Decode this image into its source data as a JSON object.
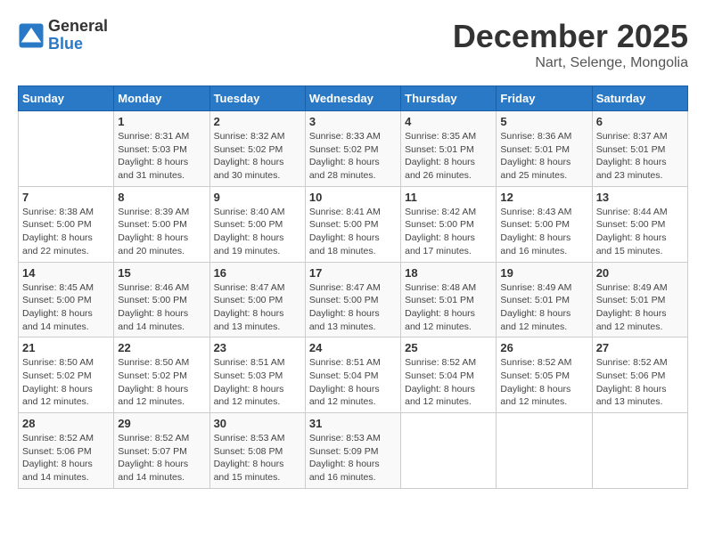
{
  "logo": {
    "line1": "General",
    "line2": "Blue"
  },
  "title": "December 2025",
  "subtitle": "Nart, Selenge, Mongolia",
  "weekdays": [
    "Sunday",
    "Monday",
    "Tuesday",
    "Wednesday",
    "Thursday",
    "Friday",
    "Saturday"
  ],
  "weeks": [
    [
      {
        "day": "",
        "info": ""
      },
      {
        "day": "1",
        "info": "Sunrise: 8:31 AM\nSunset: 5:03 PM\nDaylight: 8 hours\nand 31 minutes."
      },
      {
        "day": "2",
        "info": "Sunrise: 8:32 AM\nSunset: 5:02 PM\nDaylight: 8 hours\nand 30 minutes."
      },
      {
        "day": "3",
        "info": "Sunrise: 8:33 AM\nSunset: 5:02 PM\nDaylight: 8 hours\nand 28 minutes."
      },
      {
        "day": "4",
        "info": "Sunrise: 8:35 AM\nSunset: 5:01 PM\nDaylight: 8 hours\nand 26 minutes."
      },
      {
        "day": "5",
        "info": "Sunrise: 8:36 AM\nSunset: 5:01 PM\nDaylight: 8 hours\nand 25 minutes."
      },
      {
        "day": "6",
        "info": "Sunrise: 8:37 AM\nSunset: 5:01 PM\nDaylight: 8 hours\nand 23 minutes."
      }
    ],
    [
      {
        "day": "7",
        "info": "Sunrise: 8:38 AM\nSunset: 5:00 PM\nDaylight: 8 hours\nand 22 minutes."
      },
      {
        "day": "8",
        "info": "Sunrise: 8:39 AM\nSunset: 5:00 PM\nDaylight: 8 hours\nand 20 minutes."
      },
      {
        "day": "9",
        "info": "Sunrise: 8:40 AM\nSunset: 5:00 PM\nDaylight: 8 hours\nand 19 minutes."
      },
      {
        "day": "10",
        "info": "Sunrise: 8:41 AM\nSunset: 5:00 PM\nDaylight: 8 hours\nand 18 minutes."
      },
      {
        "day": "11",
        "info": "Sunrise: 8:42 AM\nSunset: 5:00 PM\nDaylight: 8 hours\nand 17 minutes."
      },
      {
        "day": "12",
        "info": "Sunrise: 8:43 AM\nSunset: 5:00 PM\nDaylight: 8 hours\nand 16 minutes."
      },
      {
        "day": "13",
        "info": "Sunrise: 8:44 AM\nSunset: 5:00 PM\nDaylight: 8 hours\nand 15 minutes."
      }
    ],
    [
      {
        "day": "14",
        "info": "Sunrise: 8:45 AM\nSunset: 5:00 PM\nDaylight: 8 hours\nand 14 minutes."
      },
      {
        "day": "15",
        "info": "Sunrise: 8:46 AM\nSunset: 5:00 PM\nDaylight: 8 hours\nand 14 minutes."
      },
      {
        "day": "16",
        "info": "Sunrise: 8:47 AM\nSunset: 5:00 PM\nDaylight: 8 hours\nand 13 minutes."
      },
      {
        "day": "17",
        "info": "Sunrise: 8:47 AM\nSunset: 5:00 PM\nDaylight: 8 hours\nand 13 minutes."
      },
      {
        "day": "18",
        "info": "Sunrise: 8:48 AM\nSunset: 5:01 PM\nDaylight: 8 hours\nand 12 minutes."
      },
      {
        "day": "19",
        "info": "Sunrise: 8:49 AM\nSunset: 5:01 PM\nDaylight: 8 hours\nand 12 minutes."
      },
      {
        "day": "20",
        "info": "Sunrise: 8:49 AM\nSunset: 5:01 PM\nDaylight: 8 hours\nand 12 minutes."
      }
    ],
    [
      {
        "day": "21",
        "info": "Sunrise: 8:50 AM\nSunset: 5:02 PM\nDaylight: 8 hours\nand 12 minutes."
      },
      {
        "day": "22",
        "info": "Sunrise: 8:50 AM\nSunset: 5:02 PM\nDaylight: 8 hours\nand 12 minutes."
      },
      {
        "day": "23",
        "info": "Sunrise: 8:51 AM\nSunset: 5:03 PM\nDaylight: 8 hours\nand 12 minutes."
      },
      {
        "day": "24",
        "info": "Sunrise: 8:51 AM\nSunset: 5:04 PM\nDaylight: 8 hours\nand 12 minutes."
      },
      {
        "day": "25",
        "info": "Sunrise: 8:52 AM\nSunset: 5:04 PM\nDaylight: 8 hours\nand 12 minutes."
      },
      {
        "day": "26",
        "info": "Sunrise: 8:52 AM\nSunset: 5:05 PM\nDaylight: 8 hours\nand 12 minutes."
      },
      {
        "day": "27",
        "info": "Sunrise: 8:52 AM\nSunset: 5:06 PM\nDaylight: 8 hours\nand 13 minutes."
      }
    ],
    [
      {
        "day": "28",
        "info": "Sunrise: 8:52 AM\nSunset: 5:06 PM\nDaylight: 8 hours\nand 14 minutes."
      },
      {
        "day": "29",
        "info": "Sunrise: 8:52 AM\nSunset: 5:07 PM\nDaylight: 8 hours\nand 14 minutes."
      },
      {
        "day": "30",
        "info": "Sunrise: 8:53 AM\nSunset: 5:08 PM\nDaylight: 8 hours\nand 15 minutes."
      },
      {
        "day": "31",
        "info": "Sunrise: 8:53 AM\nSunset: 5:09 PM\nDaylight: 8 hours\nand 16 minutes."
      },
      {
        "day": "",
        "info": ""
      },
      {
        "day": "",
        "info": ""
      },
      {
        "day": "",
        "info": ""
      }
    ]
  ]
}
